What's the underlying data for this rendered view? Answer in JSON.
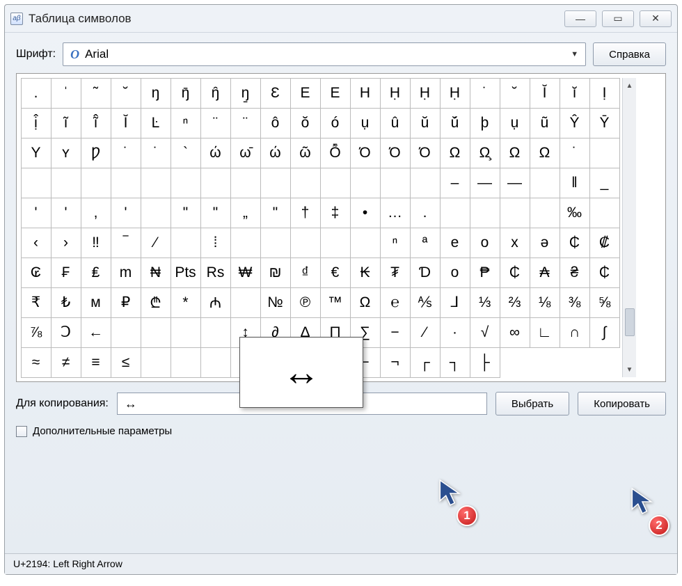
{
  "window": {
    "title": "Таблица символов",
    "min": "—",
    "max": "▭",
    "close": "✕"
  },
  "toolbar": {
    "font_label": "Шрифт:",
    "font_value": "Arial",
    "help_label": "Справка"
  },
  "grid": {
    "rows": [
      [
        ".",
        "ˈ",
        "˜",
        "˘",
        "ŋ",
        "ŋ̄",
        "ŋ̑",
        "ŋ̱",
        "Ɛ",
        "E",
        "E",
        "H",
        "Ḥ",
        "Ḥ",
        "Ḥ",
        "˙",
        "˘",
        "Ĭ",
        "ĭ",
        "Ị"
      ],
      [
        "ị̂",
        "ĩ",
        "ĩ̂",
        "Ĭ",
        "Ŀ",
        "ⁿ",
        "¨",
        "¨",
        "ô",
        "ŏ",
        "ó",
        "ụ",
        "û",
        "ŭ",
        "ŭ́",
        "þ",
        "ụ",
        "ũ",
        "Ŷ",
        "Ȳ"
      ],
      [
        "Y",
        "ʏ",
        "Ƿ",
        "˙",
        "˙",
        "`",
        "ώ",
        "ω̄",
        "ώ",
        "ῶ",
        "Ȭ",
        "Ό",
        "Ό",
        "Ό",
        "Ω",
        "Ω̧",
        "Ω",
        "Ω",
        "˙",
        ""
      ],
      [
        "",
        "",
        "",
        "",
        "",
        "",
        "",
        "",
        "",
        "",
        "",
        "",
        "",
        "",
        "‒",
        "—",
        "―",
        "",
        "‖",
        "_"
      ],
      [
        "'",
        "'",
        ",",
        "'",
        "",
        "\"",
        "\"",
        "„",
        "\"",
        "†",
        "‡",
        "•",
        "…",
        ".",
        "",
        "",
        "",
        "",
        "‰",
        ""
      ],
      [
        "‹",
        "›",
        "‼",
        "‾",
        "⁄",
        "",
        "⁞",
        "",
        "",
        "",
        "",
        "",
        "ⁿ",
        "ª",
        "e",
        "o",
        "x",
        "ə"
      ],
      [
        "₵",
        "₡",
        "₢",
        "₣",
        "₤",
        "m",
        "₦",
        "Pts",
        "Rs",
        "₩",
        "₪",
        "₫",
        "€",
        "₭",
        "₮",
        "Ɗ",
        "о",
        "₱",
        "₵",
        "₳"
      ],
      [
        "₴",
        "₵",
        "₹",
        "₺",
        "ᴍ",
        "₽",
        "₾",
        "*",
        "₼",
        "",
        "№",
        "℗",
        "™",
        "Ω",
        "℮",
        "⅍",
        "⅃",
        "⅓",
        "⅔"
      ],
      [
        "⅛",
        "⅜",
        "⅝",
        "⅞",
        "Ↄ",
        "←",
        "",
        "",
        "",
        "",
        "↕",
        "∂",
        "∆",
        "∏",
        "∑",
        "−",
        "∕",
        "·",
        "√"
      ],
      [
        "∞",
        "∟",
        "∩",
        "∫",
        "≈",
        "≠",
        "≡",
        "≤",
        "",
        "",
        "",
        "⌂",
        "",
        "",
        "⌐",
        "⌐",
        "¬",
        "┌",
        "┐",
        "├"
      ]
    ]
  },
  "preview": {
    "char": "↔"
  },
  "copy": {
    "label": "Для копирования:",
    "value": "↔",
    "select_label": "Выбрать",
    "copy_label": "Копировать"
  },
  "advanced": {
    "label": "Дополнительные параметры"
  },
  "status": {
    "text": "U+2194: Left Right Arrow"
  },
  "annotations": {
    "badge1": "1",
    "badge2": "2"
  }
}
